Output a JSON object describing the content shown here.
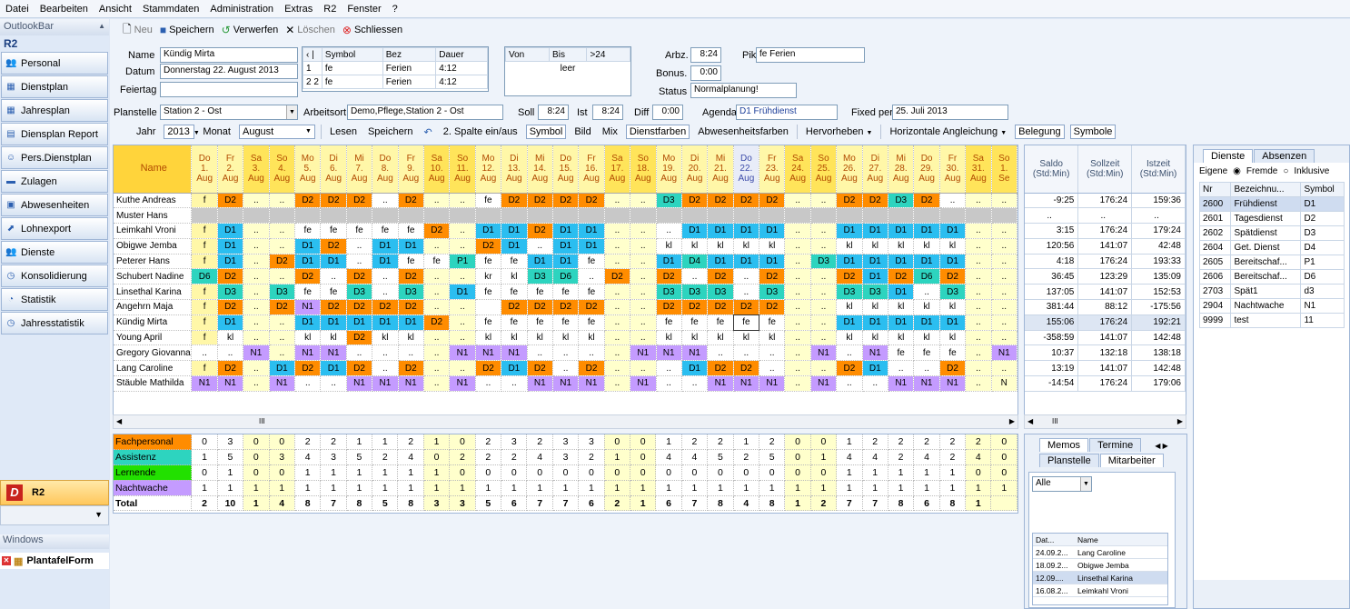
{
  "menu": [
    "Datei",
    "Bearbeiten",
    "Ansicht",
    "Stammdaten",
    "Administration",
    "Extras",
    "R2",
    "Fenster",
    "?"
  ],
  "sidebar": {
    "title": "OutlookBar",
    "section": "R2",
    "items": [
      {
        "label": "Personal",
        "icon": "people-icon"
      },
      {
        "label": "Dienstplan",
        "icon": "calendar-icon"
      },
      {
        "label": "Jahresplan",
        "icon": "calendar-icon"
      },
      {
        "label": "Diensplan Report",
        "icon": "report-icon"
      },
      {
        "label": "Pers.Dienstplan",
        "icon": "person-icon"
      },
      {
        "label": "Zulagen",
        "icon": "folder-icon"
      },
      {
        "label": "Abwesenheiten",
        "icon": "suitcase-icon"
      },
      {
        "label": "Lohnexport",
        "icon": "export-icon"
      },
      {
        "label": "Dienste",
        "icon": "people-icon"
      },
      {
        "label": "Konsolidierung",
        "icon": "clock-icon"
      },
      {
        "label": "Statistik",
        "icon": "chart-icon"
      },
      {
        "label": "Jahresstatistik",
        "icon": "clock-icon"
      }
    ],
    "bottom": "R2",
    "windows_title": "Windows",
    "window_item": "PlantafelForm"
  },
  "toolbar": {
    "new": "Neu",
    "save": "Speichern",
    "discard": "Verwerfen",
    "delete": "Löschen",
    "close": "Schliessen"
  },
  "form": {
    "name_label": "Name",
    "name": "Kündig Mirta",
    "datum_label": "Datum",
    "datum": "Donnerstag 22. August 2013",
    "feiertag_label": "Feiertag",
    "feiertag": "",
    "planstelle_label": "Planstelle",
    "planstelle": "Station 2 - Ost",
    "arbeitsort_label": "Arbeitsort",
    "arbeitsort": "Demo,Pflege,Station 2 - Ost",
    "soll_label": "Soll",
    "soll": "8:24",
    "ist_label": "Ist",
    "ist": "8:24",
    "diff_label": "Diff",
    "diff": "0:00",
    "agenda_label": "Agenda",
    "agenda": "D1 Frühdienst",
    "fixed_label": "Fixed per",
    "fixed": "25. Juli 2013",
    "arbz_label": "Arbz.",
    "arbz": "8:24",
    "bonus_label": "Bonus.",
    "bonus": "0:00",
    "status_label": "Status",
    "status": "Normalplanung!",
    "pik_label": "Pik",
    "pik": "fe Ferien",
    "jahr_label": "Jahr",
    "jahr": "2013",
    "monat_label": "Monat",
    "monat": "August"
  },
  "symtable": {
    "headers": [
      "Symbol",
      "Bez",
      "Dauer"
    ],
    "rows": [
      {
        "flag": "1",
        "sym": "fe",
        "bez": "Ferien",
        "dauer": "4:12"
      },
      {
        "flag": "2 2",
        "sym": "fe",
        "bez": "Ferien",
        "dauer": "4:12"
      }
    ]
  },
  "vonbis": {
    "headers": [
      "Von",
      "Bis",
      ">24"
    ],
    "empty": "leer"
  },
  "options": [
    "Lesen",
    "Speichern",
    "2. Spalte ein/aus",
    "Symbol",
    "Bild",
    "Mix",
    "Dienstfarben",
    "Abwesenheitsfarben",
    "Hervorheben",
    "Horizontale Angleichung",
    "Belegung",
    "Symbole"
  ],
  "grid": {
    "name_header": "Name",
    "days": [
      "Do|1.|Aug",
      "Fr|2.|Aug",
      "Sa|3.|Aug",
      "So|4.|Aug",
      "Mo|5.|Aug",
      "Di|6.|Aug",
      "Mi|7.|Aug",
      "Do|8.|Aug",
      "Fr|9.|Aug",
      "Sa|10.|Aug",
      "So|11.|Aug",
      "Mo|12.|Aug",
      "Di|13.|Aug",
      "Mi|14.|Aug",
      "Do|15.|Aug",
      "Fr|16.|Aug",
      "Sa|17.|Aug",
      "So|18.|Aug",
      "Mo|19.|Aug",
      "Di|20.|Aug",
      "Mi|21.|Aug",
      "Do|22.|Aug",
      "Fr|23.|Aug",
      "Sa|24.|Aug",
      "So|25.|Aug",
      "Mo|26.|Aug",
      "Di|27.|Aug",
      "Mi|28.|Aug",
      "Do|29.|Aug",
      "Fr|30.|Aug",
      "Sa|31.|Aug",
      "So|1.|Se"
    ],
    "rows": [
      {
        "name": "Kuthe Andreas",
        "cells": [
          "f",
          "D2",
          "..",
          "..",
          "D2",
          "D2",
          "D2",
          "..",
          "D2",
          "..",
          "..",
          "fe",
          "D2",
          "D2",
          "D2",
          "D2",
          "..",
          "..",
          "D3",
          "D2",
          "D2",
          "D2",
          "D2",
          "..",
          "..",
          "D2",
          "D2",
          "D3",
          "D2",
          "..",
          "..",
          ".."
        ]
      },
      {
        "name": "Muster Hans",
        "cells": [
          "",
          "",
          "",
          "",
          "",
          "",
          "",
          "",
          "",
          "",
          "",
          "",
          "",
          "",
          "",
          "",
          "",
          "",
          "",
          "",
          "",
          "",
          "",
          "",
          "",
          "",
          "",
          "",
          "",
          "",
          "",
          ""
        ]
      },
      {
        "name": "Leimkahl Vroni",
        "cells": [
          "f",
          "D1",
          "..",
          "..",
          "fe",
          "fe",
          "fe",
          "fe",
          "fe",
          "D2",
          "..",
          "D1",
          "D1",
          "D2",
          "D1",
          "D1",
          "..",
          "..",
          "..",
          "D1",
          "D1",
          "D1",
          "D1",
          "..",
          "..",
          "D1",
          "D1",
          "D1",
          "D1",
          "D1",
          "..",
          ".."
        ]
      },
      {
        "name": "Obigwe Jemba",
        "cells": [
          "f",
          "D1",
          "..",
          "..",
          "D1",
          "D2",
          "..",
          "D1",
          "D1",
          "..",
          "..",
          "D2",
          "D1",
          "..",
          "D1",
          "D1",
          "..",
          "..",
          "kl",
          "kl",
          "kl",
          "kl",
          "kl",
          "..",
          "..",
          "kl",
          "kl",
          "kl",
          "kl",
          "kl",
          "..",
          ".."
        ]
      },
      {
        "name": "Peterer Hans",
        "cells": [
          "f",
          "D1",
          "..",
          "D2",
          "D1",
          "D1",
          "..",
          "D1",
          "fe",
          "fe",
          "P1",
          "fe",
          "fe",
          "D1",
          "D1",
          "fe",
          "..",
          "..",
          "D1",
          "D4",
          "D1",
          "D1",
          "D1",
          "..",
          "D3",
          "D1",
          "D1",
          "D1",
          "D1",
          "D1",
          "..",
          ".."
        ]
      },
      {
        "name": "Schubert Nadine",
        "cells": [
          "D6",
          "D2",
          "..",
          "..",
          "D2",
          "..",
          "D2",
          "..",
          "D2",
          "..",
          "..",
          "kr",
          "kl",
          "D3",
          "D6",
          "..",
          "D2",
          "..",
          "D2",
          "..",
          "D2",
          "..",
          "D2",
          "..",
          "..",
          "D2",
          "D1",
          "D2",
          "D6",
          "D2",
          "..",
          ".."
        ]
      },
      {
        "name": "Linsethal Karina",
        "cells": [
          "f",
          "D3",
          "..",
          "D3",
          "fe",
          "fe",
          "D3",
          "..",
          "D3",
          "..",
          "D1",
          "fe",
          "fe",
          "fe",
          "fe",
          "fe",
          "..",
          "..",
          "D3",
          "D3",
          "D3",
          "..",
          "D3",
          "..",
          "..",
          "D3",
          "D3",
          "D1",
          "..",
          "D3",
          "..",
          ".."
        ]
      },
      {
        "name": "Angehrn  Maja",
        "cells": [
          "f",
          "D2",
          "..",
          "D2",
          "N1",
          "D2",
          "D2",
          "D2",
          "D2",
          "..",
          "..",
          "",
          "D2",
          "D2",
          "D2",
          "D2",
          "..",
          "..",
          "D2",
          "D2",
          "D2",
          "D2",
          "D2",
          "..",
          "..",
          "kl",
          "kl",
          "kl",
          "kl",
          "kl",
          "..",
          ".."
        ]
      },
      {
        "name": "Kündig Mirta",
        "cells": [
          "f",
          "D1",
          "..",
          "..",
          "D1",
          "D1",
          "D1",
          "D1",
          "D1",
          "D2",
          "..",
          "fe",
          "fe",
          "fe",
          "fe",
          "fe",
          "..",
          "..",
          "fe",
          "fe",
          "fe",
          "fe",
          "fe",
          "..",
          "..",
          "D1",
          "D1",
          "D1",
          "D1",
          "D1",
          "..",
          ".."
        ]
      },
      {
        "name": "Young April",
        "cells": [
          "f",
          "kl",
          "..",
          "..",
          "kl",
          "kl",
          "D2",
          "kl",
          "kl",
          "..",
          "..",
          "kl",
          "kl",
          "kl",
          "kl",
          "kl",
          "..",
          "..",
          "kl",
          "kl",
          "kl",
          "kl",
          "kl",
          "..",
          "..",
          "kl",
          "kl",
          "kl",
          "kl",
          "kl",
          "..",
          ".."
        ]
      },
      {
        "name": "Gregory Giovanna",
        "cells": [
          "..",
          "..",
          "N1",
          "..",
          "N1",
          "N1",
          "..",
          "..",
          "..",
          "..",
          "N1",
          "N1",
          "N1",
          "..",
          "..",
          "..",
          "..",
          "N1",
          "N1",
          "N1",
          "..",
          "..",
          "..",
          "..",
          "N1",
          "..",
          "N1",
          "fe",
          "fe",
          "fe",
          "..",
          "N1"
        ]
      },
      {
        "name": "Lang Caroline",
        "cells": [
          "f",
          "D2",
          "..",
          "D1",
          "D2",
          "D1",
          "D2",
          "..",
          "D2",
          "..",
          "..",
          "D2",
          "D1",
          "D2",
          "..",
          "D2",
          "..",
          "..",
          "..",
          "D1",
          "D2",
          "D2",
          "..",
          "..",
          "..",
          "D2",
          "D1",
          "..",
          "..",
          "D2",
          "..",
          ".."
        ]
      },
      {
        "name": "Stäuble Mathilda",
        "cells": [
          "N1",
          "N1",
          "..",
          "N1",
          "..",
          "..",
          "N1",
          "N1",
          "N1",
          "..",
          "N1",
          "..",
          "..",
          "N1",
          "N1",
          "N1",
          "..",
          "N1",
          "..",
          "..",
          "N1",
          "N1",
          "N1",
          "..",
          "N1",
          "..",
          "..",
          "N1",
          "N1",
          "N1",
          "..",
          "N"
        ]
      }
    ]
  },
  "colors": {
    "D1": "#2bbef0",
    "D2": "#ff8c00",
    "D3": "#2dd4bf",
    "D4": "#2dd4bf",
    "D6": "#2dd4bf",
    "N1": "#c49bff",
    "P1": "#2dd4bf",
    "kr": "#ffffff",
    "kl": "#ffffff",
    "fe": "#ffffff",
    "f": "#fff7a8",
    "empty_row": "#c8c8c8",
    "weekend": "#ffffcc",
    "fachpersonal": "#ff8c00",
    "assistenz": "#2dd4bf",
    "lernende": "#22e000",
    "nachtwache": "#c49bff",
    "total": "#ffffff"
  },
  "stats": {
    "rows": [
      {
        "name": "Fachpersonal",
        "color_key": "fachpersonal",
        "values": [
          "0",
          "3",
          "0",
          "0",
          "2",
          "2",
          "1",
          "1",
          "2",
          "1",
          "0",
          "2",
          "3",
          "2",
          "3",
          "3",
          "0",
          "0",
          "1",
          "2",
          "2",
          "1",
          "2",
          "0",
          "0",
          "1",
          "2",
          "2",
          "2",
          "2",
          "2",
          "0"
        ]
      },
      {
        "name": "Assistenz",
        "color_key": "assistenz",
        "values": [
          "1",
          "5",
          "0",
          "3",
          "4",
          "3",
          "5",
          "2",
          "4",
          "0",
          "2",
          "2",
          "2",
          "4",
          "3",
          "2",
          "1",
          "0",
          "4",
          "4",
          "5",
          "2",
          "5",
          "0",
          "1",
          "4",
          "4",
          "2",
          "4",
          "2",
          "4",
          "0"
        ]
      },
      {
        "name": "Lernende",
        "color_key": "lernende",
        "values": [
          "0",
          "1",
          "0",
          "0",
          "1",
          "1",
          "1",
          "1",
          "1",
          "1",
          "0",
          "0",
          "0",
          "0",
          "0",
          "0",
          "0",
          "0",
          "0",
          "0",
          "0",
          "0",
          "0",
          "0",
          "0",
          "1",
          "1",
          "1",
          "1",
          "1",
          "0",
          "0"
        ]
      },
      {
        "name": "Nachtwache",
        "color_key": "nachtwache",
        "values": [
          "1",
          "1",
          "1",
          "1",
          "1",
          "1",
          "1",
          "1",
          "1",
          "1",
          "1",
          "1",
          "1",
          "1",
          "1",
          "1",
          "1",
          "1",
          "1",
          "1",
          "1",
          "1",
          "1",
          "1",
          "1",
          "1",
          "1",
          "1",
          "1",
          "1",
          "1",
          "1"
        ]
      },
      {
        "name": "Total",
        "color_key": "total",
        "values": [
          "2",
          "10",
          "1",
          "4",
          "8",
          "7",
          "8",
          "5",
          "8",
          "3",
          "3",
          "5",
          "6",
          "7",
          "7",
          "6",
          "2",
          "1",
          "6",
          "7",
          "8",
          "4",
          "8",
          "1",
          "2",
          "7",
          "7",
          "8",
          "6",
          "8",
          "1",
          ""
        ]
      }
    ]
  },
  "saldo": {
    "headers": [
      "Saldo (Std:Min)",
      "Sollzeit (Std:Min)",
      "Istzeit (Std:Min)"
    ],
    "rows": [
      [
        "-9:25",
        "176:24",
        "159:36"
      ],
      [
        "..",
        "..",
        ".."
      ],
      [
        "3:15",
        "176:24",
        "179:24"
      ],
      [
        "120:56",
        "141:07",
        "42:48"
      ],
      [
        "4:18",
        "176:24",
        "193:33"
      ],
      [
        "36:45",
        "123:29",
        "135:09"
      ],
      [
        "137:05",
        "141:07",
        "152:53"
      ],
      [
        "381:44",
        "88:12",
        "-175:56"
      ],
      [
        "155:06",
        "176:24",
        "192:21"
      ],
      [
        "-358:59",
        "141:07",
        "142:48"
      ],
      [
        "10:37",
        "132:18",
        "138:18"
      ],
      [
        "13:19",
        "141:07",
        "142:48"
      ],
      [
        "-14:54",
        "176:24",
        "179:06"
      ]
    ]
  },
  "memo": {
    "tabs": [
      "Memos",
      "Termine"
    ],
    "subtabs": [
      "Planstelle",
      "Mitarbeiter"
    ],
    "filter": "Alle",
    "headers": [
      "Dat...",
      "Name"
    ],
    "rows": [
      [
        "24.09.2...",
        "Lang Caroline"
      ],
      [
        "18.09.2...",
        "Obigwe Jemba"
      ],
      [
        "12.09....",
        "Linsethal Karina"
      ],
      [
        "16.08.2...",
        "Leimkahl Vroni"
      ]
    ]
  },
  "dienste": {
    "tabs": [
      "Dienste",
      "Absenzen"
    ],
    "radios": [
      "Eigene",
      "Fremde",
      "Inklusive"
    ],
    "headers": [
      "Nr",
      "Bezeichnu...",
      "Symbol"
    ],
    "rows": [
      [
        "2600",
        "Frühdienst",
        "D1"
      ],
      [
        "2601",
        "Tagesdienst",
        "D2"
      ],
      [
        "2602",
        "Spätdienst",
        "D3"
      ],
      [
        "2604",
        "Get. Dienst",
        "D4"
      ],
      [
        "2605",
        "Bereitschaf...",
        "P1"
      ],
      [
        "2606",
        "Bereitschaf...",
        "D6"
      ],
      [
        "2703",
        "Spät1",
        "d3"
      ],
      [
        "2904",
        "Nachtwache",
        "N1"
      ],
      [
        "9999",
        "test",
        "11"
      ]
    ]
  }
}
